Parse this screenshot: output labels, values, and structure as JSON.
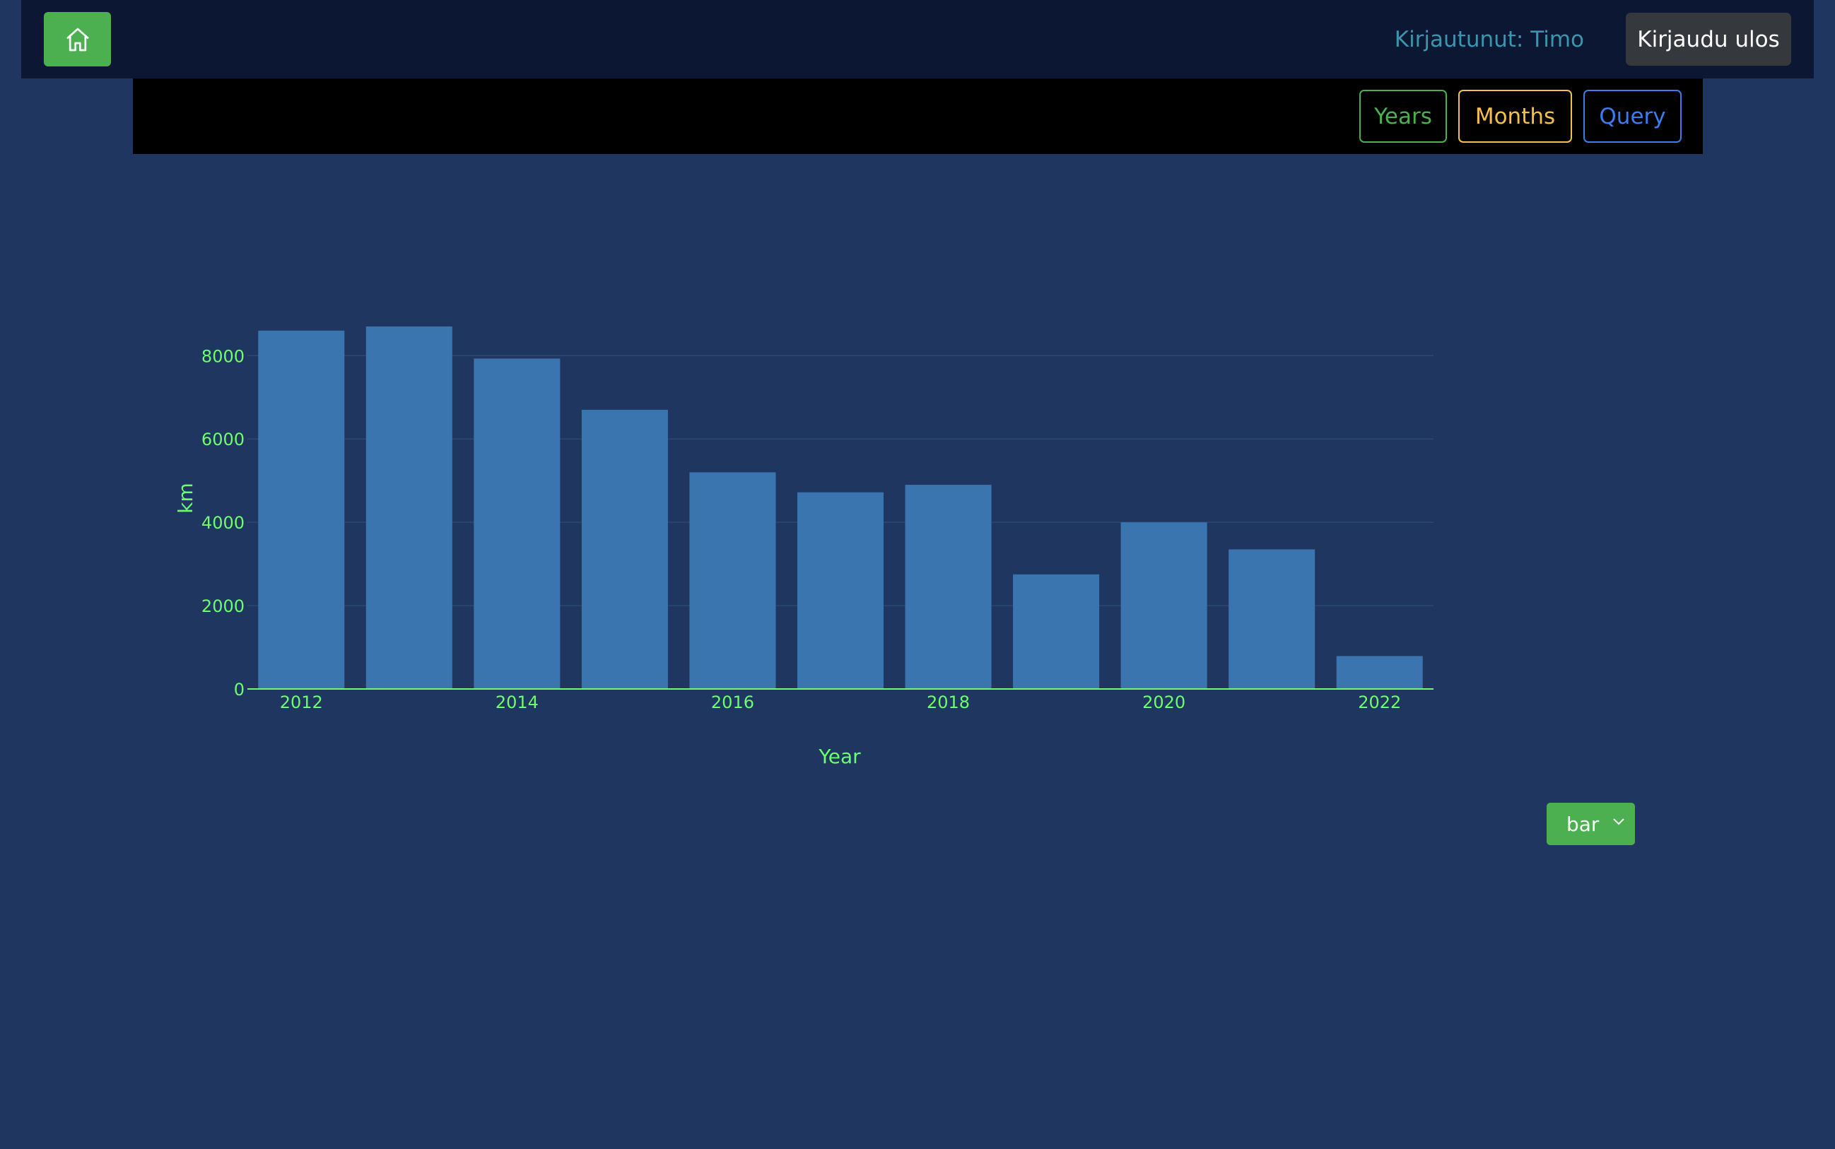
{
  "nav": {
    "user_label": "Kirjautunut: Timo",
    "logout_label": "Kirjaudu ulos"
  },
  "tabs": {
    "years": "Years",
    "months": "Months",
    "query": "Query"
  },
  "chart_type_select": {
    "value": "bar"
  },
  "colors": {
    "bar": "#3a75b0",
    "axis_text": "#6cff6c",
    "home_button": "#4caf50"
  },
  "chart_data": {
    "type": "bar",
    "x": [
      2012,
      2013,
      2014,
      2015,
      2016,
      2017,
      2018,
      2019,
      2020,
      2021,
      2022
    ],
    "values": [
      8600,
      8700,
      7930,
      6700,
      5200,
      4720,
      4900,
      2750,
      4000,
      3350,
      790
    ],
    "xticks": [
      "2012",
      "2014",
      "2016",
      "2018",
      "2020",
      "2022"
    ],
    "yticks": [
      "0",
      "2000",
      "4000",
      "6000",
      "8000"
    ],
    "xlabel": "Year",
    "ylabel": "km",
    "ylim": [
      0,
      8700
    ],
    "grid": true
  }
}
